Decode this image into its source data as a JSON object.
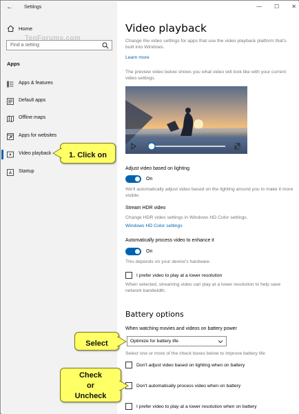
{
  "window": {
    "title": "Settings",
    "controls": [
      "—",
      "☐",
      "✕"
    ]
  },
  "sidebar": {
    "home_label": "Home",
    "search_placeholder": "Find a setting",
    "watermark": "TenForums.com",
    "section": "Apps",
    "items": [
      {
        "label": "Apps & features",
        "icon": "list-icon"
      },
      {
        "label": "Default apps",
        "icon": "default-apps-icon"
      },
      {
        "label": "Offline maps",
        "icon": "map-icon"
      },
      {
        "label": "Apps for websites",
        "icon": "link-window-icon"
      },
      {
        "label": "Video playback",
        "icon": "video-icon",
        "active": true
      },
      {
        "label": "Startup",
        "icon": "startup-icon"
      }
    ]
  },
  "main": {
    "title": "Video playback",
    "intro": "Change the video settings for apps that use the video playback platform that's built into Windows.",
    "learn_more": "Learn more",
    "preview_desc": "The preview video below shows you what video will look like with your current video settings.",
    "adjust_title": "Adjust video based on lighting",
    "adjust_state": "On",
    "adjust_desc": "We'll automatically adjust video based on the lighting around you to make it more visible.",
    "hdr_title": "Stream HDR video",
    "hdr_desc": "Change HDR video settings in Windows HD Color settings.",
    "hdr_link": "Windows HD Color settings",
    "auto_title": "Automatically process video to enhance it",
    "auto_state": "On",
    "auto_desc": "This depends on your device's hardware.",
    "lowres_label": "I prefer video to play at a lower resolution",
    "lowres_desc": "When selected, streaming video can play at a lower resolution to help save network bandwidth.",
    "battery_title": "Battery options",
    "battery_prompt": "When watching movies and videos on battery power",
    "battery_select": "Optimize for battery life",
    "battery_desc": "Select one or more of the check boxes below to improve battery life:",
    "battery_checks": [
      "Don't adjust video based on lighting when on battery",
      "Don't automatically process video when on battery",
      "I prefer video to play at a lower resolution when on battery"
    ]
  },
  "callouts": {
    "click_on": "1. Click on",
    "select": "Select",
    "check_line1": "Check",
    "check_line2": "or",
    "check_line3": "Uncheck"
  },
  "colors": {
    "accent": "#0063b1",
    "callout": "#ffff66",
    "sidebar_bg": "#f2f2f2"
  }
}
